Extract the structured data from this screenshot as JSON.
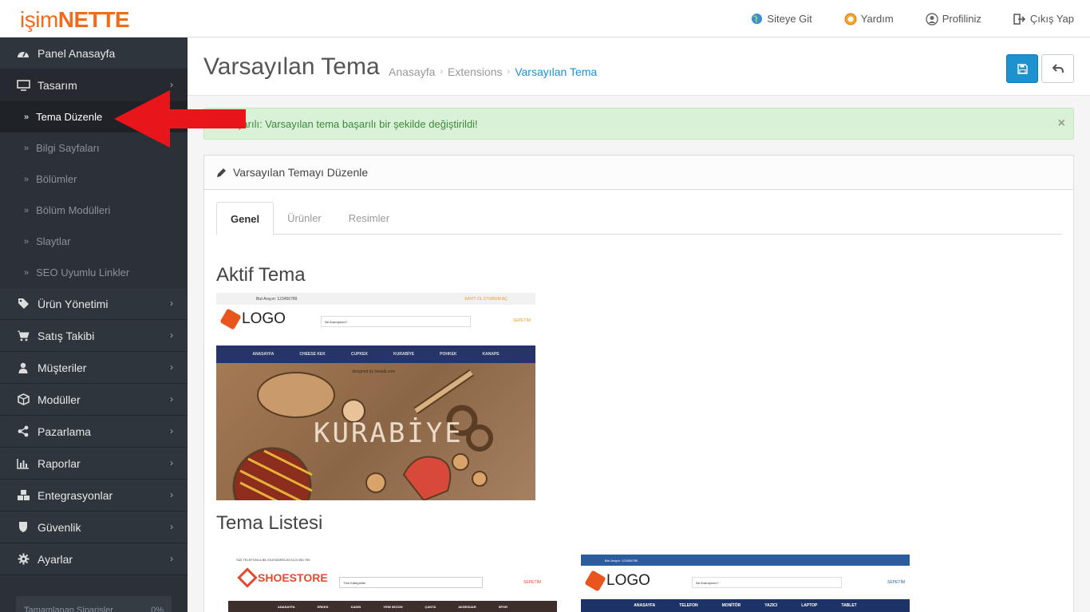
{
  "brand": {
    "prefix": "işim",
    "suffix": "NETTE"
  },
  "topnav": {
    "visit_site": "Siteye Git",
    "help": "Yardım",
    "profile": "Profiliniz",
    "logout": "Çıkış Yap"
  },
  "sidebar": {
    "dashboard": "Panel Anasayfa",
    "design": "Tasarım",
    "design_sub": [
      "Tema Düzenle",
      "Bilgi Sayfaları",
      "Bölümler",
      "Bölüm Modülleri",
      "Slaytlar",
      "SEO Uyumlu Linkler"
    ],
    "items": [
      "Ürün Yönetimi",
      "Satış Takibi",
      "Müşteriler",
      "Modüller",
      "Pazarlama",
      "Raporlar",
      "Entegrasyonlar",
      "Güvenlik",
      "Ayarlar"
    ],
    "progress_label": "Tamamlanan Siparişler",
    "progress_value": "0%"
  },
  "page": {
    "title": "Varsayılan Tema",
    "breadcrumb": [
      "Anasayfa",
      "Extensions",
      "Varsayılan Tema"
    ]
  },
  "alert": {
    "text": "Başarılı: Varsayılan tema başarılı bir şekilde değiştirildi!",
    "close": "×"
  },
  "panel": {
    "heading": "Varsayılan Temayı Düzenle",
    "tabs": [
      "Genel",
      "Ürünler",
      "Resimler"
    ],
    "active_theme_title": "Aktif Tema",
    "theme_list_title": "Tema Listesi"
  },
  "themes": {
    "kurabiye": {
      "topbar": "Bizi Arayın: 123456789",
      "topbar_right": "KAYIT OL   OTURUM AÇ",
      "logo": "LOGO",
      "search": "Ne Aramıştınız?",
      "cart": "SEPETİM",
      "nav": [
        "ANASAYFA",
        "CHEESE KEK",
        "CUPKEK",
        "KURABİYE",
        "POHKEK",
        "KANAPE"
      ],
      "credit": "designed by freepik.com",
      "hero": "KURABİYE"
    },
    "shoe": {
      "topbar": "SİZİ TELEFONLA BİLGİLENDİRELİM   0123 456 789",
      "logo": "SHOESTORE",
      "search": "Tüm Kategoriler",
      "cart": "SEPETİM",
      "nav": [
        "ANASAYFA",
        "ERKEK",
        "KADIN",
        "YENİ SEZON",
        "ÇANTA",
        "AKSESUAR",
        "SPOR"
      ]
    },
    "electronics": {
      "topbar": "Bizi Arayın: 123456789",
      "logo": "LOGO",
      "search": "Ne Aramıştınız?",
      "cart": "SEPETİM",
      "nav": [
        "ANASAYFA",
        "TELEFON",
        "MONİTÖR",
        "YAZICI",
        "LAPTOP",
        "TABLET"
      ]
    }
  },
  "colors": {
    "brand": "#f26a1b",
    "sidebar": "#2f353c",
    "primary": "#1e91cf",
    "success_bg": "#d9f1d6",
    "arrow": "#e8151b"
  }
}
